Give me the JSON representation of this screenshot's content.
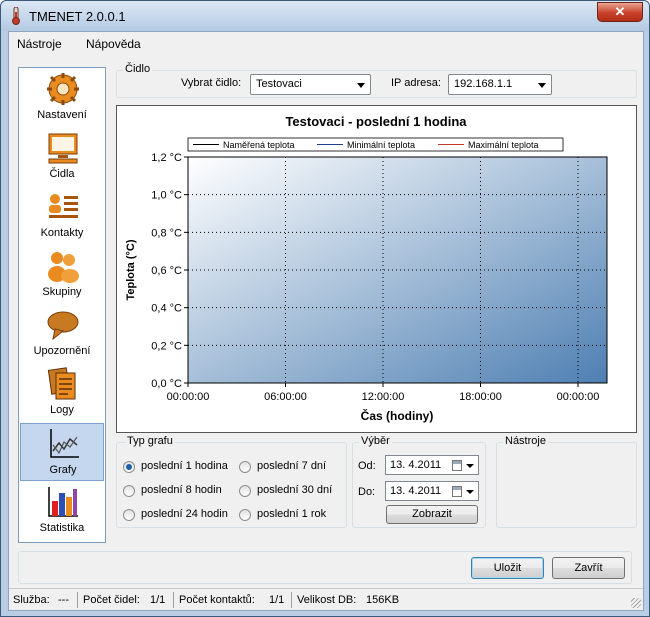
{
  "window": {
    "title": "TMENET 2.0.0.1",
    "close_label": "✕"
  },
  "menu": {
    "items": [
      "Nástroje",
      "Nápověda"
    ]
  },
  "sidebar": {
    "items": [
      {
        "label": "Nastavení",
        "icon": "gear-icon",
        "selected": false
      },
      {
        "label": "Čidla",
        "icon": "monitor-icon",
        "selected": false
      },
      {
        "label": "Kontakty",
        "icon": "contact-card-icon",
        "selected": false
      },
      {
        "label": "Skupiny",
        "icon": "group-users-icon",
        "selected": false
      },
      {
        "label": "Upozornění",
        "icon": "speech-bubble-icon",
        "selected": false
      },
      {
        "label": "Logy",
        "icon": "documents-icon",
        "selected": false
      },
      {
        "label": "Grafy",
        "icon": "line-graph-icon",
        "selected": true
      },
      {
        "label": "Statistika",
        "icon": "bar-chart-icon",
        "selected": false
      }
    ]
  },
  "sensor": {
    "group_label": "Čidlo",
    "select_label": "Vybrat čidlo:",
    "select_value": "Testovaci",
    "ip_label": "IP adresa:",
    "ip_value": "192.168.1.1"
  },
  "graph_type": {
    "group_label": "Typ grafu",
    "options": [
      {
        "label": "poslední 1 hodina",
        "checked": true
      },
      {
        "label": "poslední 8 hodin",
        "checked": false
      },
      {
        "label": "poslední 24 hodin",
        "checked": false
      },
      {
        "label": "poslední 7 dní",
        "checked": false
      },
      {
        "label": "poslední 30 dní",
        "checked": false
      },
      {
        "label": "poslední 1 rok",
        "checked": false
      }
    ]
  },
  "selection": {
    "group_label": "Výběr",
    "from_label": "Od:",
    "from_value": "13.  4.2011",
    "to_label": "Do:",
    "to_value": "13.  4.2011",
    "show_button": "Zobrazit"
  },
  "tools": {
    "group_label": "Nástroje"
  },
  "actions": {
    "save": "Uložit",
    "close": "Zavřít"
  },
  "status": {
    "service_label": "Služba:",
    "service_value": "---",
    "sensors_label": "Počet čidel:",
    "sensors_value": "1/1",
    "contacts_label": "Počet kontaktů:",
    "contacts_value": "1/1",
    "db_label": "Velikost DB:",
    "db_value": "156KB"
  },
  "colors": {
    "plot_start": "#ffffff",
    "plot_end": "#4e7fb2",
    "measured": "#000000",
    "minimum": "#1f3f8f",
    "maximum": "#c0392b"
  },
  "chart_data": {
    "type": "line",
    "title": "Testovaci - poslední 1 hodina",
    "xlabel": "Čas (hodiny)",
    "ylabel": "Teplota (°C)",
    "x_ticks": [
      "00:00:00",
      "06:00:00",
      "12:00:00",
      "18:00:00",
      "00:00:00"
    ],
    "y_ticks": [
      "0,0 °C",
      "0,2 °C",
      "0,4 °C",
      "0,6 °C",
      "0,8 °C",
      "1,0 °C",
      "1,2 °C"
    ],
    "ylim": [
      0,
      1.2
    ],
    "grid": true,
    "legend_position": "top",
    "series": [
      {
        "name": "Naměřená teplota",
        "values": []
      },
      {
        "name": "Minimální teplota",
        "values": []
      },
      {
        "name": "Maximální teplota",
        "values": []
      }
    ]
  }
}
